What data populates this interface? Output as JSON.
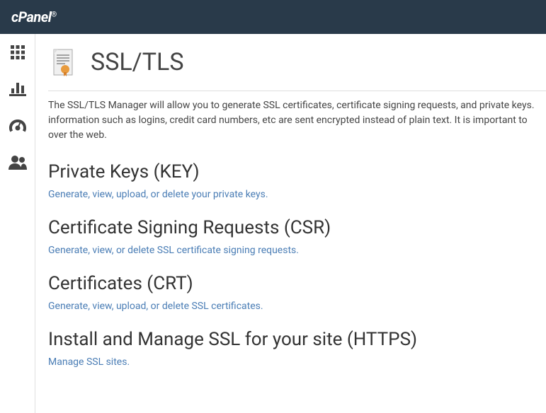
{
  "header": {
    "logo": "cPanel"
  },
  "page": {
    "title": "SSL/TLS",
    "intro_line1": "The SSL/TLS Manager will allow you to generate SSL certificates, certificate signing requests, and private keys.",
    "intro_line2": "information such as logins, credit card numbers, etc are sent encrypted instead of plain text. It is important to",
    "intro_line3": "over the web."
  },
  "sections": [
    {
      "title": "Private Keys (KEY)",
      "link": "Generate, view, upload, or delete your private keys."
    },
    {
      "title": "Certificate Signing Requests (CSR)",
      "link": "Generate, view, or delete SSL certificate signing requests."
    },
    {
      "title": "Certificates (CRT)",
      "link": "Generate, view, upload, or delete SSL certificates."
    },
    {
      "title": "Install and Manage SSL for your site (HTTPS)",
      "link": "Manage SSL sites."
    }
  ]
}
